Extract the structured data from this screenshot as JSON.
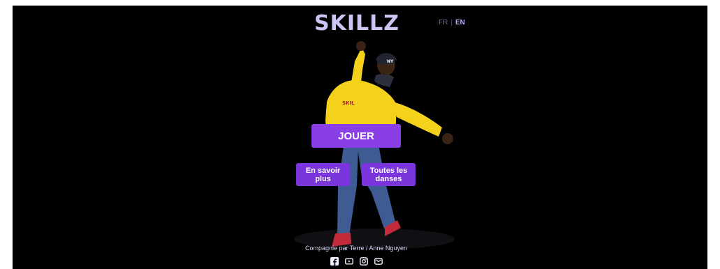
{
  "header": {
    "logo": "SKILLZ",
    "languages": {
      "fr": "FR",
      "separator": "|",
      "en": "EN",
      "active": "EN"
    }
  },
  "actions": {
    "play_label": "JOUER",
    "learn_more_label": "En savoir plus",
    "all_dances_label": "Toutes les danses"
  },
  "footer": {
    "credit": "Compagnie par Terre / Anne Nguyen",
    "social_icons": [
      "facebook-icon",
      "youtube-icon",
      "instagram-icon",
      "email-icon"
    ]
  },
  "colors": {
    "background": "#000000",
    "logo": "#c9c6f3",
    "accent": "#7b35dd",
    "active_language": "#b7b1ff",
    "dancer_hoodie": "#f4d21b",
    "dancer_jeans": "#3e5c93"
  }
}
